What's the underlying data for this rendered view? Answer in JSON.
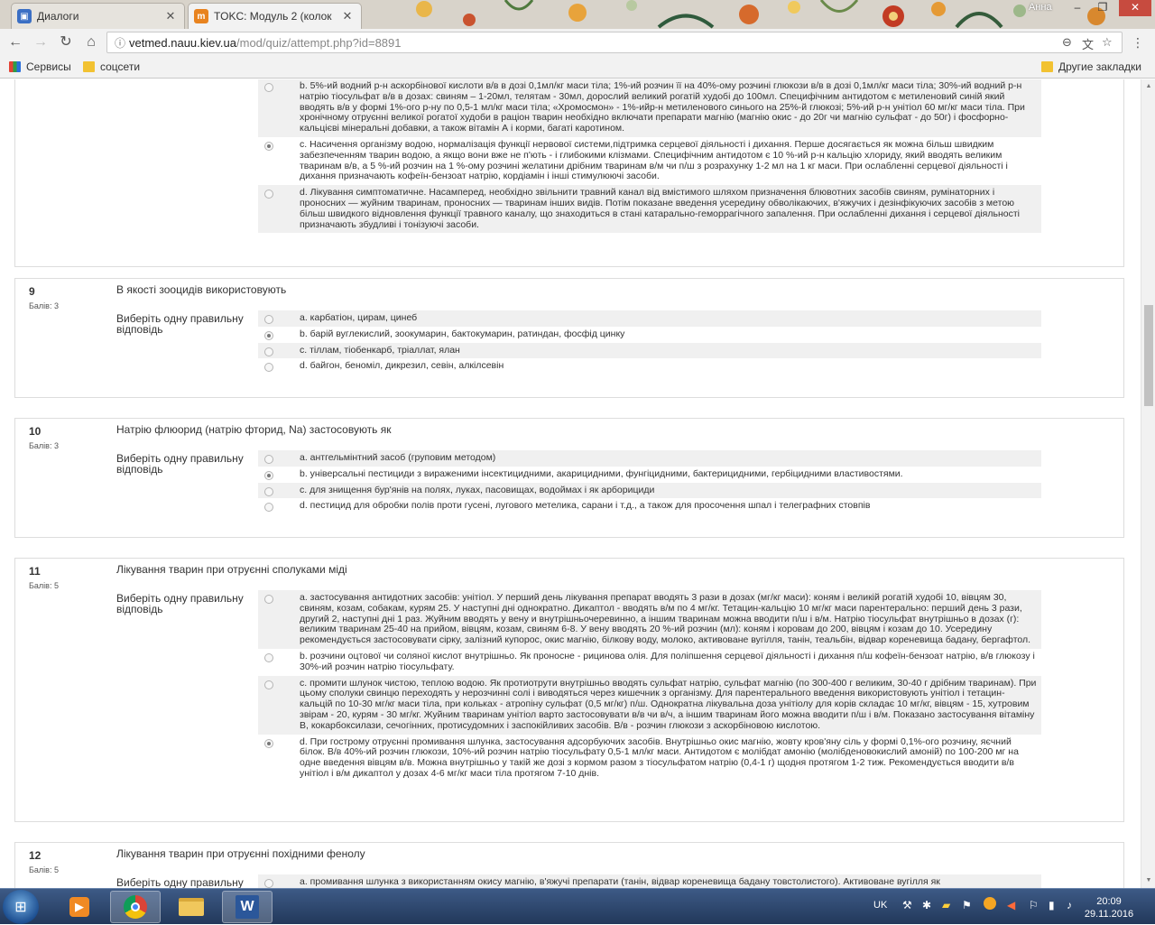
{
  "browser": {
    "tabs": [
      {
        "label": "Диалоги",
        "active": false,
        "favicon_color": "#3b6fc4"
      },
      {
        "label": "TOKC: Модуль 2 (колок",
        "active": true,
        "favicon_color": "#e8831f"
      }
    ],
    "user": "Анна",
    "url_host": "vetmed.nauu.kiev.ua",
    "url_path": "/mod/quiz/attempt.php?id=8891",
    "bookmarks": [
      {
        "label": "Сервисы",
        "icon": "apps-grid-icon"
      },
      {
        "label": "соцсети",
        "icon": "folder-icon"
      }
    ],
    "other_bookmarks": "Другие закладки"
  },
  "quiz": {
    "prev_question": {
      "options": [
        {
          "text": "b. 5%-ий водний р-н аскорбінової кислоти в/в в дозі 0,1мл/кг маси тіла; 1%-ий розчин її на 40%-ому розчині глюкози в/в в дозі 0,1мл/кг маси тіла; 30%-ий водний р-н натрію тіосульфат в/в в дозах: свиням – 1-20мл, телятам - 30мл, дорослий великий рогатій худобі до 100мл. Специфічним антидотом є метиленовий синій який вводять в/в у формі 1%-ого р-ну по 0,5-1 мл/кг маси тіла; «Хромосмон» - 1%-ийр-н метиленового синього на 25%-й глюкозі; 5%-ий р-н унітіол 60 мг/кг маси тіла. При хронічному отруєнні великої рогатої худоби в раціон тварин необхідно включати препарати магнію (магнію окис - до 20г чи магнію сульфат - до 50г) і фосфорно-кальцієві мінеральні добавки, а також вітамін А і корми, багаті каротином.",
          "selected": false
        },
        {
          "text": "c. Насичення організму водою, нормалізація функції нервової системи,підтримка серцевої діяльності і дихання. Перше досягається як можна більш швидким забезпеченням тварин водою, а якщо вони вже не п'ють - і глибокими клізмами. Специфічним антидотом є 10 %-ий р-н кальцію хлориду, який вводять великим тваринам в/в, а 5 %-ий розчин на 1 %-ому розчині желатини дрібним тваринам в/м чи п/ш з розрахунку 1-2 мл на 1 кг маси. При ослабленні серцевої діяльності і дихання призначають кофеїн-бензоат натрію, кордіамін і інші стимулюючі засоби.",
          "selected": true
        },
        {
          "text": "d. Лікування симптоматичне. Насамперед, необхідно звільнити травний канал від вмістимого шляхом призначення блювотних засобів свиням, румінаторних і проносних — жуйним тваринам, проносних — тваринам інших видів. Потім показане введення усередину обволікаючих, в'яжучих і дезінфікуючих засобів з метою більш швидкого відновлення функції травного каналу, що знаходиться в стані катарально-геморрагічного запалення. При ослабленні дихання і серцевої діяльності призначають збудливі і тонізуючі засоби.",
          "selected": false
        }
      ]
    },
    "prompt_label": "Виберіть одну правильну відповідь",
    "questions": [
      {
        "number": "9",
        "mark": "Балів: 3",
        "text": "В якості зооцидів використовують",
        "options": [
          {
            "text": "a. карбатіон, цирам, цинеб",
            "selected": false
          },
          {
            "text": "b. барій вуглекислий, зоокумарин, бактокумарин, ратиндан, фосфід цинку",
            "selected": true
          },
          {
            "text": "c. тіллам, тіобенкарб, тріаллат, ялан",
            "selected": false
          },
          {
            "text": "d. байгон, беноміл, дикрезил, севін, алкілсевін",
            "selected": false
          }
        ]
      },
      {
        "number": "10",
        "mark": "Балів: 3",
        "text": "Натрію флюорид (натрію фторид, Na) застосовують як",
        "options": [
          {
            "text": "a. антгельмінтний засоб (груповим методом)",
            "selected": false
          },
          {
            "text": "b. універсальні пестициди з вираженими інсектицидними, акарицидними, фунгіцидними, бактерицидними, гербіцидними властивостями.",
            "selected": true
          },
          {
            "text": "c. для знищення бур'янів на полях, луках, пасовищах, водоймах і як арборициди",
            "selected": false
          },
          {
            "text": "d. пестицид для обробки полів проти гусені, лугового метелика, сарани і т.д., а також для просочення шпал і телеграфних стовпів",
            "selected": false
          }
        ]
      },
      {
        "number": "11",
        "mark": "Балів: 5",
        "text": "Лікування тварин при отруєнні сполуками міді",
        "options": [
          {
            "text": "a. застосування антидотних засобів: унітіол. У перший день лікування препарат вводять 3 рази в дозах (мг/кг маси): коням і великій рогатій худобі 10, вівцям 30, свиням, козам, собакам, курям 25. У наступні дні однократно. Дикаптол - вводять в/м по 4 мг/кг. Тетацин-кальцію 10 мг/кг маси парентерально: перший день 3 рази, другий 2, наступні дні 1 раз. Жуйним вводять у вену и внутрішньочеревинно, а іншим тваринам можна вводити п/ш і в/м. Натрію тіосульфат внутрішньо в дозах (г): великим тваринам 25-40 на прийом, вівцям, козам, свиням 6-8. У вену вводять 20 %-ий розчин (мл): коням і коровам до 200, вівцям і козам до 10. Усередину рекомендується застосовувати сірку, залізний купорос, окис магнію, білкову воду, молоко, активоване вугілля, танін, теальбін, відвар кореневища бадану, бергафтол.",
            "selected": false
          },
          {
            "text": "b. розчини оцтової чи соляної кислот внутрішньо. Як проносне - рицинова олія. Для поліпшення серцевої діяльності і дихання п/ш кофеїн-бензоат натрію, в/в глюкозу і 30%-ий розчин натрію тіосульфату.",
            "selected": false
          },
          {
            "text": "c. промити шлунок чистою, теплою водою. Як протиотрути внутрішньо вводять сульфат натрію, сульфат магнію (по 300-400 г великим, 30-40 г дрібним тваринам). При цьому сполуки свинцю переходять у нерозчинні солі і виводяться через кишечник з організму. Для парентерального введення використовують унітіол і тетацин-кальцій по 10-30 мг/кг маси тіла, при кольках - атропіну сульфат (0,5 мг/кг) п/ш. Однократна лікувальна доза унітіолу для корів складає 10 мг/кг, вівцям - 15, хутровим звірам - 20, курям - 30 мг/кг. Жуйним тваринам унітіол варто застосовувати в/в чи в/ч, а іншим тваринам його можна вводити п/ш і в/м. Показано застосування вітаміну В, кокарбоксилази, сечогінних, протисудомних і заспокійливих засобів. В/в - розчин глюкози з аскорбіновою кислотою.",
            "selected": false
          },
          {
            "text": "d. При гострому отруєнні промивання шлунка, застосування адсорбуючих засобів. Внутрішньо окис магнію, жовту кров'яну сіль у формі 0,1%-ого розчину, яєчний білок. В/в 40%-ий розчин глюкози, 10%-ий розчин натрію тіосульфату 0,5-1 мл/кг маси. Антидотом є молібдат амонію (молібденовокислий амоній) по 100-200 мг на одне введення вівцям в/в. Можна внутрішньо у такій же дозі з кормом разом з тіосульфатом натрію (0,4-1 г) щодня протягом 1-2 тиж. Рекомендується вводити в/в унітіол і в/м дикаптол у дозах 4-6 мг/кг маси тіла протягом 7-10 днів.",
            "selected": true
          }
        ]
      },
      {
        "number": "12",
        "mark": "Балів: 5",
        "text": "Лікування тварин при отруєнні похідними фенолу",
        "options": [
          {
            "text": "a. промивання шлунка з використанням окису магнію, в'яжучі препарати (танін, відвар кореневища бадану товстолистого). Активоване вугілля як",
            "selected": false
          }
        ]
      }
    ]
  },
  "taskbar": {
    "lang": "UK",
    "time": "20:09",
    "date": "29.11.2016",
    "apps": [
      "media-player-icon",
      "chrome-icon",
      "explorer-icon",
      "word-icon"
    ]
  }
}
